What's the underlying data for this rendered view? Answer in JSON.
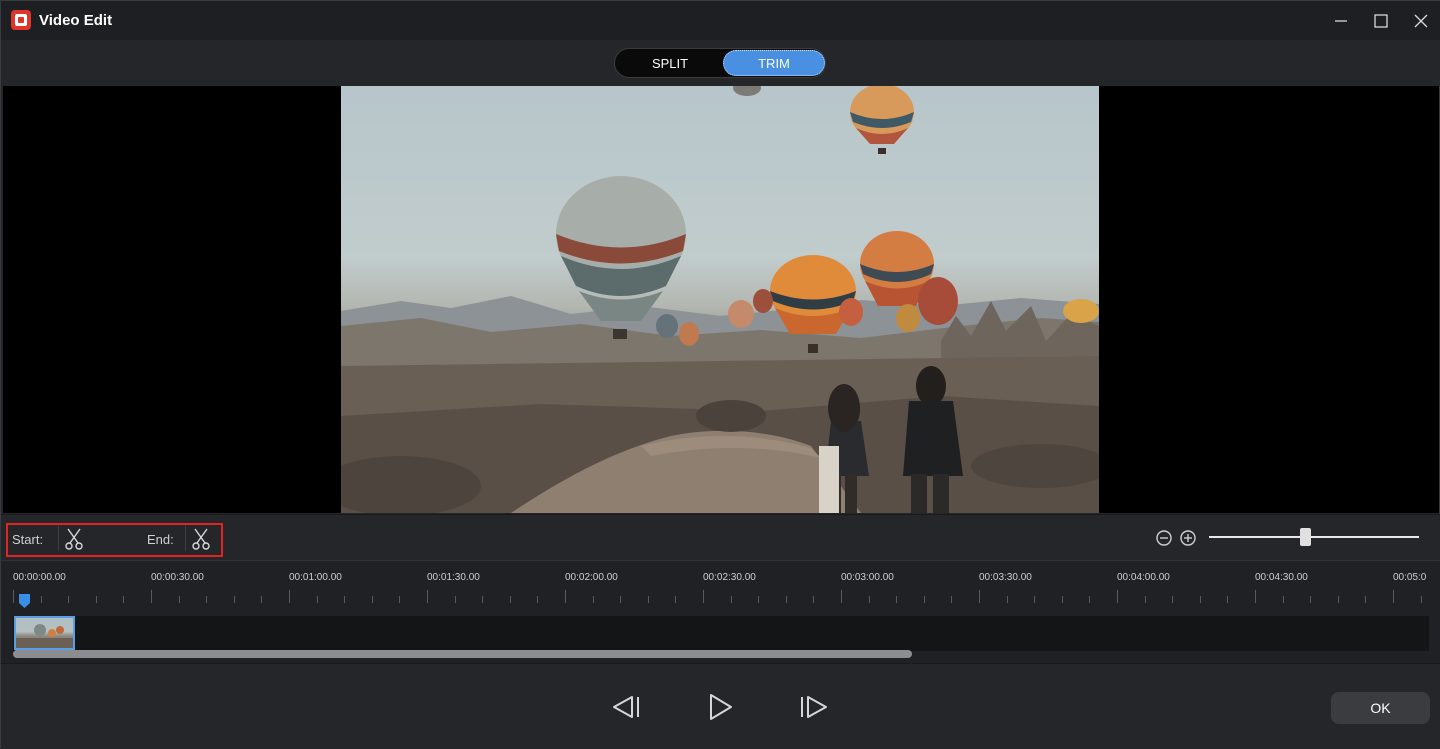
{
  "window": {
    "title": "Video Edit"
  },
  "mode_toggle": {
    "split_label": "SPLIT",
    "trim_label": "TRIM",
    "active": "TRIM"
  },
  "trim_controls": {
    "start_label": "Start:",
    "end_label": "End:"
  },
  "zoom": {
    "level_fraction": 0.46
  },
  "timeline": {
    "ruler_labels": [
      "00:00:00.00",
      "00:00:30.00",
      "00:01:00.00",
      "00:01:30.00",
      "00:02:00.00",
      "00:02:30.00",
      "00:03:00.00",
      "00:03:30.00",
      "00:04:00.00",
      "00:04:30.00",
      "00:05:0"
    ],
    "playhead_time": "00:00:00.00"
  },
  "playback": {
    "prev_frame_icon": "step-back-icon",
    "play_icon": "play-icon",
    "next_frame_icon": "step-forward-icon"
  },
  "footer": {
    "ok_label": "OK"
  },
  "colors": {
    "accent": "#4a90e2",
    "highlight_box": "#e02424",
    "app_icon": "#e0352b"
  }
}
